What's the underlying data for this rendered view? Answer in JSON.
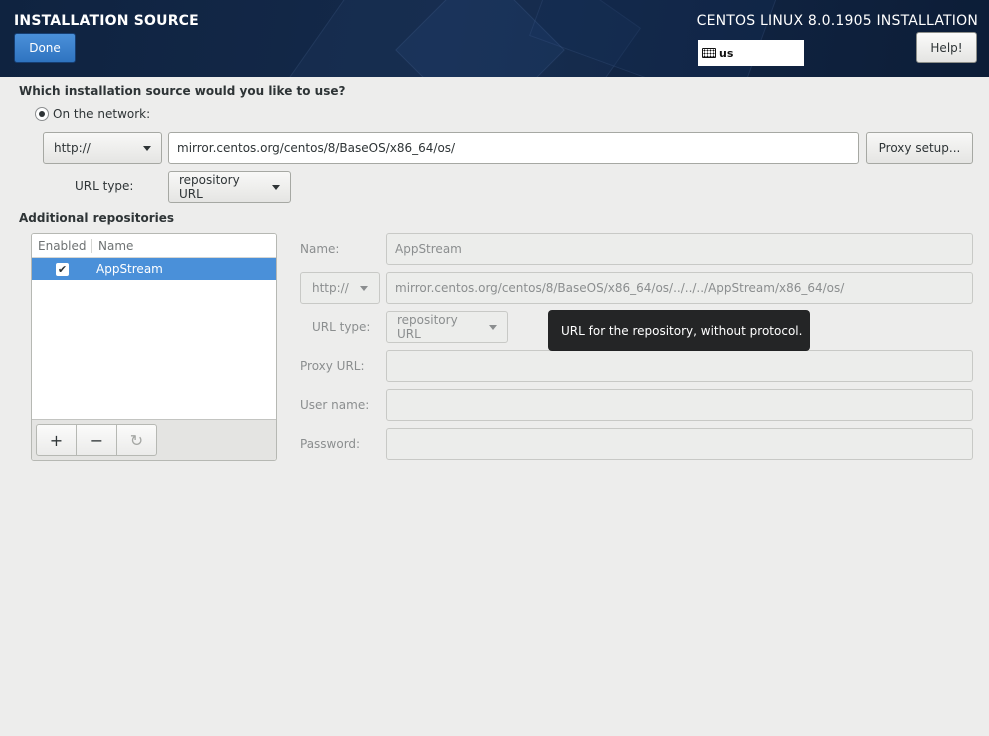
{
  "header": {
    "page_title": "INSTALLATION SOURCE",
    "done_label": "Done",
    "product_title": "CENTOS LINUX 8.0.1905 INSTALLATION",
    "keyboard_layout": "us",
    "help_label": "Help!"
  },
  "source": {
    "question": "Which installation source would you like to use?",
    "network_option": "On the network:",
    "protocol": "http://",
    "url": "mirror.centos.org/centos/8/BaseOS/x86_64/os/",
    "proxy_button": "Proxy setup...",
    "url_type_label": "URL type:",
    "url_type": "repository URL"
  },
  "additional": {
    "heading": "Additional repositories",
    "columns": {
      "enabled": "Enabled",
      "name": "Name"
    },
    "repos": [
      {
        "enabled": true,
        "name": "AppStream"
      }
    ],
    "toolbar": {
      "add": "+",
      "remove": "−",
      "reset": "↻"
    }
  },
  "repo_form": {
    "name_label": "Name:",
    "name_value": "AppStream",
    "protocol": "http://",
    "url": "mirror.centos.org/centos/8/BaseOS/x86_64/os/../../../AppStream/x86_64/os/",
    "url_type_label": "URL type:",
    "url_type": "repository URL",
    "proxy_url_label": "Proxy URL:",
    "user_name_label": "User name:",
    "password_label": "Password:"
  },
  "tooltip": "URL for the repository, without protocol.",
  "colors": {
    "accent": "#4a90d9",
    "header_bg": "#14294a",
    "background": "#ededec"
  }
}
